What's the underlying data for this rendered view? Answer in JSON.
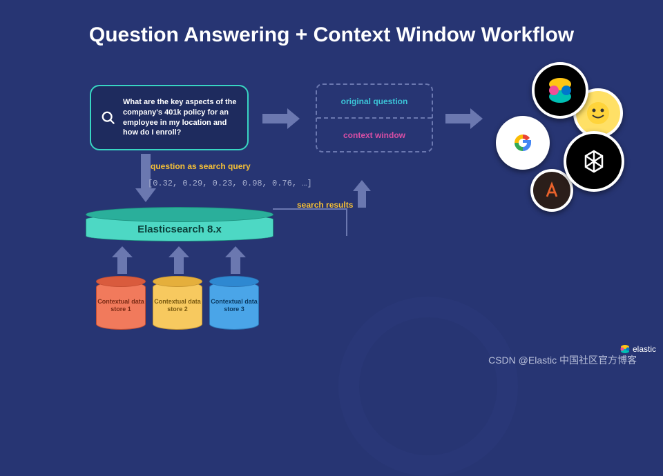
{
  "title": "Question Answering + Context Window Workflow",
  "question": "What are the key aspects of the company's 401k policy for an employee in my location and how do I enroll?",
  "labels": {
    "query": "question as search query",
    "vector": "[0.32, 0.29, 0.23, 0.98, 0.76, …]",
    "results": "search results",
    "original_q": "original question",
    "context_w": "context window"
  },
  "elasticsearch": "Elasticsearch 8.x",
  "datastores": [
    "Contextual data store 1",
    "Contextual data store 2",
    "Contextual data store 3"
  ],
  "llm_providers": [
    "Elastic",
    "Hugging Face",
    "Google",
    "OpenAI",
    "Anthropic"
  ],
  "footer": {
    "watermark": "CSDN @Elastic 中国社区官方博客",
    "brand": "elastic"
  }
}
